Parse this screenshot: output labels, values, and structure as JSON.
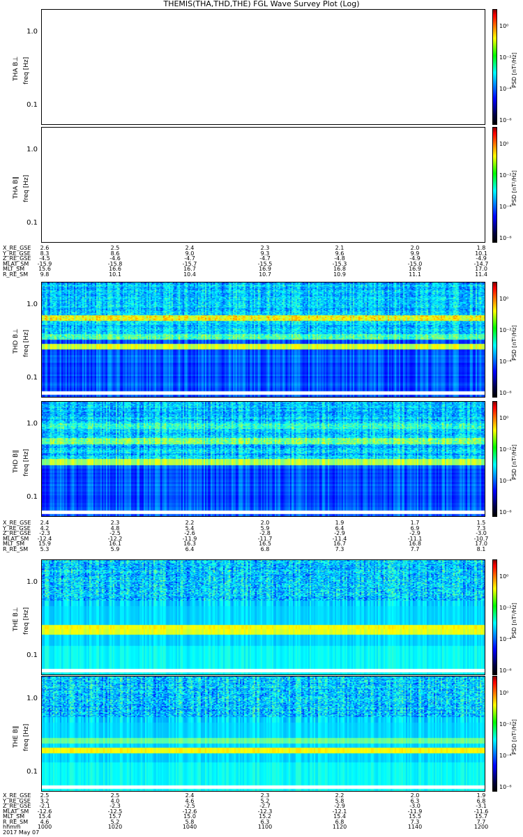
{
  "title": "THEMIS(THA,THD,THE) FGL Wave Survey Plot (Log)",
  "date_label": "2017 May 07",
  "chart_data": [
    {
      "type": "heatmap",
      "probe": "THA",
      "panel": "THA B⊥",
      "ylabel": "freq [Hz]",
      "yscale": "log",
      "yticks": [
        "1.0",
        "0.1"
      ],
      "data": "none",
      "colorbar": [
        "10⁰",
        "10⁻²",
        "10⁻⁴",
        "10⁻⁶"
      ],
      "colorbar_label": "PSD [nT²/Hz]"
    },
    {
      "type": "heatmap",
      "probe": "THA",
      "panel": "THA B∥",
      "ylabel": "freq [Hz]",
      "yscale": "log",
      "yticks": [
        "1.0",
        "0.1"
      ],
      "data": "none",
      "colorbar": [
        "10⁰",
        "10⁻²",
        "10⁻⁴",
        "10⁻⁶"
      ],
      "colorbar_label": "PSD [nT²/Hz]"
    },
    {
      "type": "heatmap",
      "probe": "THD",
      "panel": "THD B⊥",
      "ylabel": "freq [Hz]",
      "yscale": "log",
      "yticks": [
        "1.0",
        "0.1"
      ],
      "colorbar": [
        "10⁰",
        "10⁻²",
        "10⁻⁴",
        "10⁻⁶"
      ],
      "colorbar_label": "PSD [nT²/Hz]"
    },
    {
      "type": "heatmap",
      "probe": "THD",
      "panel": "THD B∥",
      "ylabel": "freq [Hz]",
      "yscale": "log",
      "yticks": [
        "1.0",
        "0.1"
      ],
      "colorbar": [
        "10⁰",
        "10⁻²",
        "10⁻⁴",
        "10⁻⁶"
      ],
      "colorbar_label": "PSD [nT²/Hz]"
    },
    {
      "type": "heatmap",
      "probe": "THE",
      "panel": "THE B⊥",
      "ylabel": "freq [Hz]",
      "yscale": "log",
      "yticks": [
        "1.0",
        "0.1"
      ],
      "colorbar": [
        "10⁰",
        "10⁻²",
        "10⁻⁴",
        "10⁻⁶"
      ],
      "colorbar_label": "PSD [nT²/Hz]"
    },
    {
      "type": "heatmap",
      "probe": "THE",
      "panel": "THE B∥",
      "ylabel": "freq [Hz]",
      "yscale": "log",
      "yticks": [
        "1.0",
        "0.1"
      ],
      "colorbar": [
        "10⁰",
        "10⁻²",
        "10⁻⁴",
        "10⁻⁶"
      ],
      "colorbar_label": "PSD [nT²/Hz]"
    }
  ],
  "ephemeris_labels": [
    "X_RE_GSE",
    "Y_RE_GSE",
    "Z_RE_GSE",
    "MLAT_SM",
    "MLT_SM",
    "R_RE_SM"
  ],
  "ephemeris": {
    "THA": [
      [
        "2.6",
        "2.5",
        "2.4",
        "2.3",
        "2.1",
        "2.0",
        "1.8"
      ],
      [
        "8.3",
        "8.6",
        "9.0",
        "9.3",
        "9.6",
        "9.9",
        "10.1"
      ],
      [
        "-4.5",
        "-4.6",
        "-4.7",
        "-4.7",
        "-4.8",
        "-4.9",
        "-4.9"
      ],
      [
        "-15.9",
        "-15.8",
        "-15.7",
        "-15.5",
        "-15.3",
        "-15.0",
        "-14.7"
      ],
      [
        "15.6",
        "16.6",
        "16.7",
        "16.9",
        "16.8",
        "16.9",
        "17.0"
      ],
      [
        "9.8",
        "10.1",
        "10.4",
        "10.7",
        "10.9",
        "11.1",
        "11.4"
      ]
    ],
    "THD": [
      [
        "2.4",
        "2.3",
        "2.2",
        "2.0",
        "1.9",
        "1.7",
        "1.5"
      ],
      [
        "4.2",
        "4.8",
        "5.4",
        "5.9",
        "6.4",
        "6.9",
        "7.3"
      ],
      [
        "-2.3",
        "-2.5",
        "-2.6",
        "-2.8",
        "-2.9",
        "-2.9",
        "-3.0"
      ],
      [
        "-12.4",
        "-12.2",
        "-11.9",
        "-11.7",
        "-11.4",
        "-11.1",
        "-10.7"
      ],
      [
        "15.9",
        "16.1",
        "16.3",
        "16.5",
        "16.7",
        "16.8",
        "17.0"
      ],
      [
        "5.3",
        "5.9",
        "6.4",
        "6.8",
        "7.3",
        "7.7",
        "8.1"
      ]
    ],
    "THE": [
      [
        "2.5",
        "2.5",
        "2.4",
        "2.3",
        "2.2",
        "2.0",
        "1.9"
      ],
      [
        "3.2",
        "4.0",
        "4.6",
        "5.2",
        "5.8",
        "6.3",
        "6.8"
      ],
      [
        "-2.1",
        "-2.3",
        "-2.5",
        "-2.7",
        "-2.9",
        "-3.0",
        "-3.1"
      ],
      [
        "-12.6",
        "-12.5",
        "-12.6",
        "-12.3",
        "-12.1",
        "-11.9",
        "-11.6"
      ],
      [
        "15.4",
        "15.7",
        "15.0",
        "15.2",
        "15.4",
        "15.5",
        "15.7"
      ],
      [
        "4.6",
        "5.2",
        "5.8",
        "6.3",
        "6.8",
        "7.3",
        "7.7"
      ]
    ],
    "hhmm_label": "hhmm",
    "hhmm": [
      "1000",
      "1020",
      "1040",
      "1100",
      "1120",
      "1140",
      "1200"
    ]
  }
}
